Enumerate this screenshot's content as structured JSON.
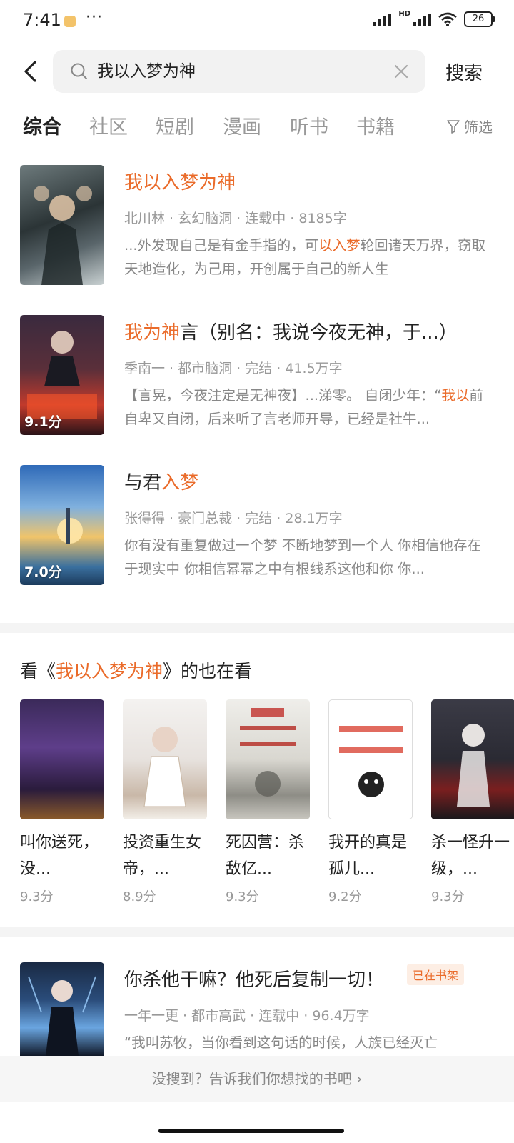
{
  "status_bar": {
    "time": "7:41",
    "dots": "···",
    "network": "HD",
    "battery": "26"
  },
  "search": {
    "query": "我以入梦为神",
    "button_label": "搜索"
  },
  "tabs": [
    {
      "label": "综合"
    },
    {
      "label": "社区"
    },
    {
      "label": "短剧"
    },
    {
      "label": "漫画"
    },
    {
      "label": "听书"
    },
    {
      "label": "书籍"
    }
  ],
  "filter_label": "筛选",
  "results": [
    {
      "title_hl": "我以入梦为神",
      "title_rest": "",
      "meta": "北川林 · 玄幻脑洞 · 连载中 · 8185字",
      "desc_a": "...外发现自己是有金手指的，可",
      "desc_hl": "以入梦",
      "desc_b": "轮回诸天万界，窃取天地造化，为己用，开创属于自己的新人生",
      "rating": ""
    },
    {
      "title_hl": "我为神",
      "title_rest": "言（别名：我说今夜无神，于...）",
      "meta": "季南一 · 都市脑洞 · 完结 · 41.5万字",
      "desc_a": "【言晃，今夜注定是无神夜】...涕零。 自闭少年：“",
      "desc_hl": "我以",
      "desc_b": "前自卑又自闭，后来听了言老师开导，已经是社牛...",
      "rating": "9.1分"
    },
    {
      "title_pre": "与君",
      "title_hl": "入梦",
      "title_rest": "",
      "meta": "张得得 · 豪门总裁 · 完结 · 28.1万字",
      "desc_a": "你有没有重复做过一个梦 不断地梦到一个人 你相信他存在于现实中 你相信幂幂之中有根线系这他和你 你...",
      "desc_hl": "",
      "desc_b": "",
      "rating": "7.0分"
    }
  ],
  "also_reading": {
    "prefix": "看《",
    "book": "我以入梦为神",
    "suffix": "》的也在看",
    "items": [
      {
        "title": "叫你送死，没...",
        "rating": "9.3分"
      },
      {
        "title": "投资重生女帝，...",
        "rating": "8.9分"
      },
      {
        "title": "死囚营：杀敌亿...",
        "rating": "9.3分"
      },
      {
        "title": "我开的真是孤儿...",
        "rating": "9.2分"
      },
      {
        "title": "杀一怪升一级，...",
        "rating": "9.3分"
      }
    ]
  },
  "extra_result": {
    "title": "你杀他干嘛？他死后复制一切！",
    "shelf_tag": "已在书架",
    "meta": "一年一更 · 都市高武 · 连载中 · 96.4万字",
    "desc": "“我叫苏牧，当你看到这句话的时候，人族已经灭亡"
  },
  "footer": {
    "text": "没搜到？告诉我们你想找的书吧 ›"
  },
  "colors": {
    "highlight": "#ea6b2a",
    "muted": "#999999"
  }
}
